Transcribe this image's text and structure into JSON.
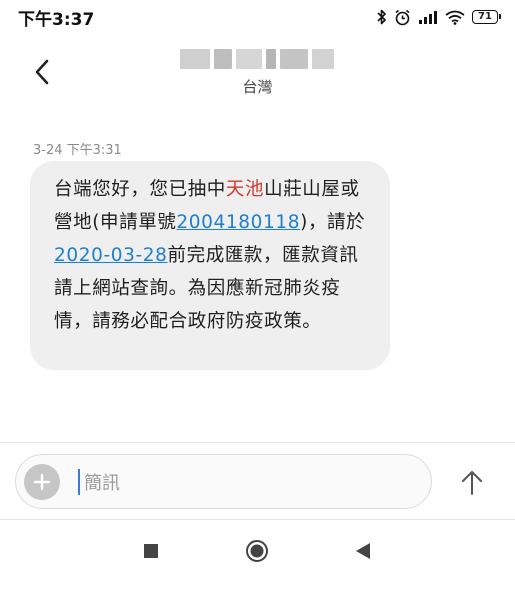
{
  "status_bar": {
    "time": "下午3:37",
    "battery": "71",
    "icons": [
      "bluetooth-icon",
      "alarm-icon",
      "signal-icon",
      "wifi-icon",
      "battery-icon"
    ]
  },
  "header": {
    "contact_region": "台灣",
    "back_icon": "back-arrow-icon"
  },
  "message": {
    "timestamp": "3-24 下午3:31",
    "seg1": "台端您好，您已抽中",
    "seg2": "天池",
    "seg3": "山莊山屋或營地(申請單號",
    "seg4": "2004180118",
    "seg5": ")，請於",
    "seg6": "2020-03-28",
    "seg7": "前完成匯款，匯款資訊請上網站查詢。為因應新冠肺炎疫情，請務必配合政府防疫政策。"
  },
  "composer": {
    "placeholder": "簡訊",
    "add_icon": "plus-icon",
    "send_icon": "send-arrow-icon"
  },
  "nav_bar": {
    "icons": [
      "recents-square-icon",
      "home-circle-icon",
      "back-triangle-icon"
    ]
  },
  "colors": {
    "bubble": "#efefef",
    "link": "#1e7fd0",
    "highlight": "#d23a2a"
  }
}
